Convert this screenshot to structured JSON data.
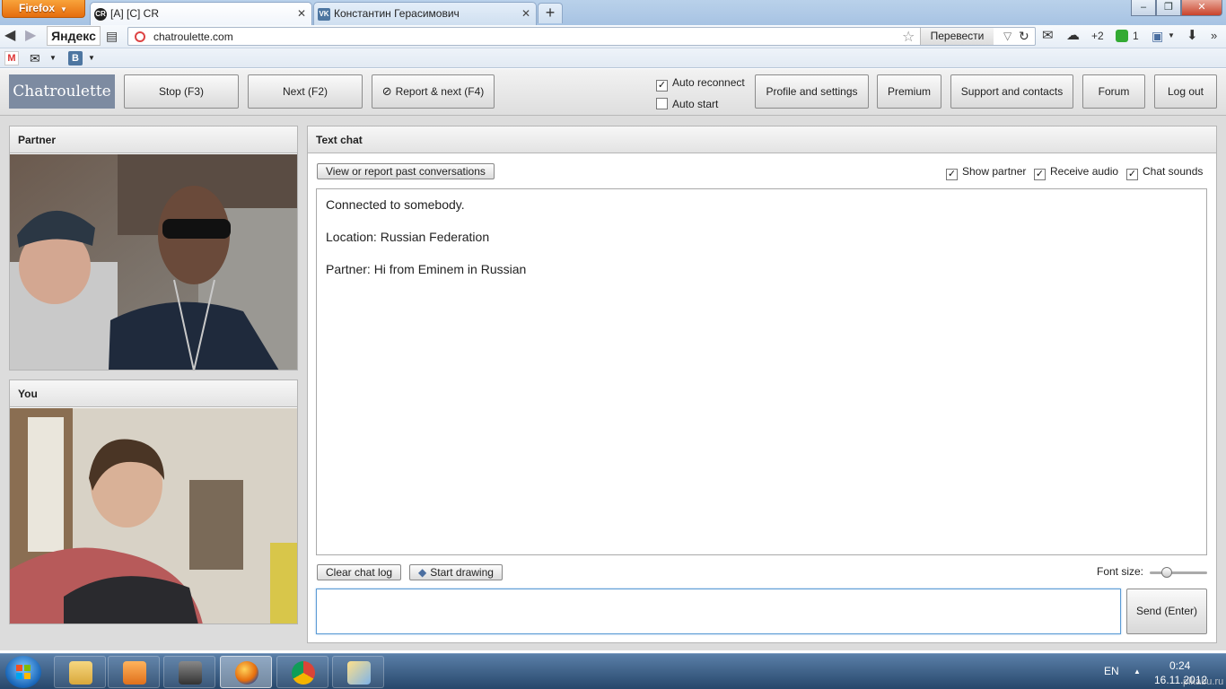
{
  "browser": {
    "menu_label": "Firefox",
    "tabs": [
      {
        "title": "[A] [C] CR",
        "favicon": "CR"
      },
      {
        "title": "Константин Герасимович",
        "favicon": "VK"
      }
    ],
    "window_controls": {
      "minimize": "–",
      "maximize": "❐",
      "close": "✕"
    },
    "search_brand": "Яндекс",
    "url": "chatroulette.com",
    "translate_label": "Перевести",
    "mail_badge": "+2",
    "counter_badge": "1",
    "bookmarks": [
      {
        "label": "M",
        "icon": "gmail-icon"
      },
      {
        "label": "✉",
        "icon": "mail-icon"
      },
      {
        "label": "В",
        "icon": "vk-icon"
      }
    ]
  },
  "app": {
    "logo": "Chatroulette",
    "buttons": {
      "stop": "Stop (F3)",
      "next": "Next (F2)",
      "report_next": "Report & next (F4)",
      "profile": "Profile and settings",
      "premium": "Premium",
      "support": "Support and contacts",
      "forum": "Forum",
      "logout": "Log out"
    },
    "options": {
      "auto_reconnect": {
        "label": "Auto reconnect",
        "checked": true
      },
      "auto_start": {
        "label": "Auto start",
        "checked": false
      }
    },
    "partner_panel": {
      "title": "Partner"
    },
    "you_panel": {
      "title": "You"
    },
    "chat": {
      "title": "Text chat",
      "view_report_button": "View or report past conversations",
      "toggles": [
        {
          "label": "Show partner",
          "checked": true
        },
        {
          "label": "Receive audio",
          "checked": true
        },
        {
          "label": "Chat sounds",
          "checked": true
        }
      ],
      "messages": [
        "Connected to somebody.",
        "Location: Russian Federation",
        "Partner: Hi from Eminem in Russian"
      ],
      "clear_button": "Clear chat log",
      "drawing_button": "Start drawing",
      "font_size_label": "Font size:",
      "font_size_fraction": 0.25,
      "input_value": "",
      "send_button": "Send (Enter)"
    }
  },
  "taskbar": {
    "language": "EN",
    "time": "0:24",
    "date": "16.11.2012",
    "watermark": "pikabu.ru"
  }
}
